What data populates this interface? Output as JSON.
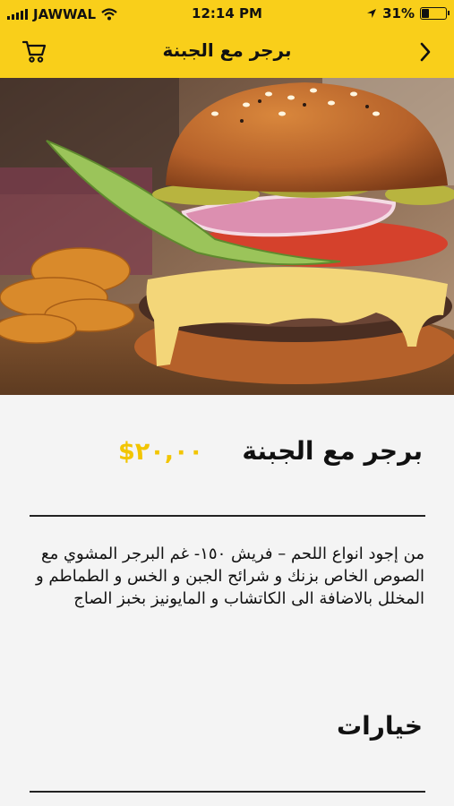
{
  "status_bar": {
    "carrier": "JAWWAL",
    "time": "12:14 PM",
    "battery": "31%",
    "battery_level": 0.31
  },
  "header": {
    "title": "برجر مع الجبنة",
    "cart_icon": "cart-icon",
    "back_icon": "chevron-right-icon"
  },
  "product": {
    "name": "برجر مع الجبنة",
    "price": "٢٠,٠٠$",
    "description": "من إجود انواع اللحم – فريش ١٥٠- غم البرجر المشوي مع الصوص الخاص بزنك و شرائح الجبن و الخس و الطماطم و المخلل بالاضافة الى الكاتشاب و المايونيز  بخبز الصاج"
  },
  "options": {
    "title": "خيارات"
  },
  "colors": {
    "accent": "#f9cf1a",
    "price": "#f2c500"
  }
}
